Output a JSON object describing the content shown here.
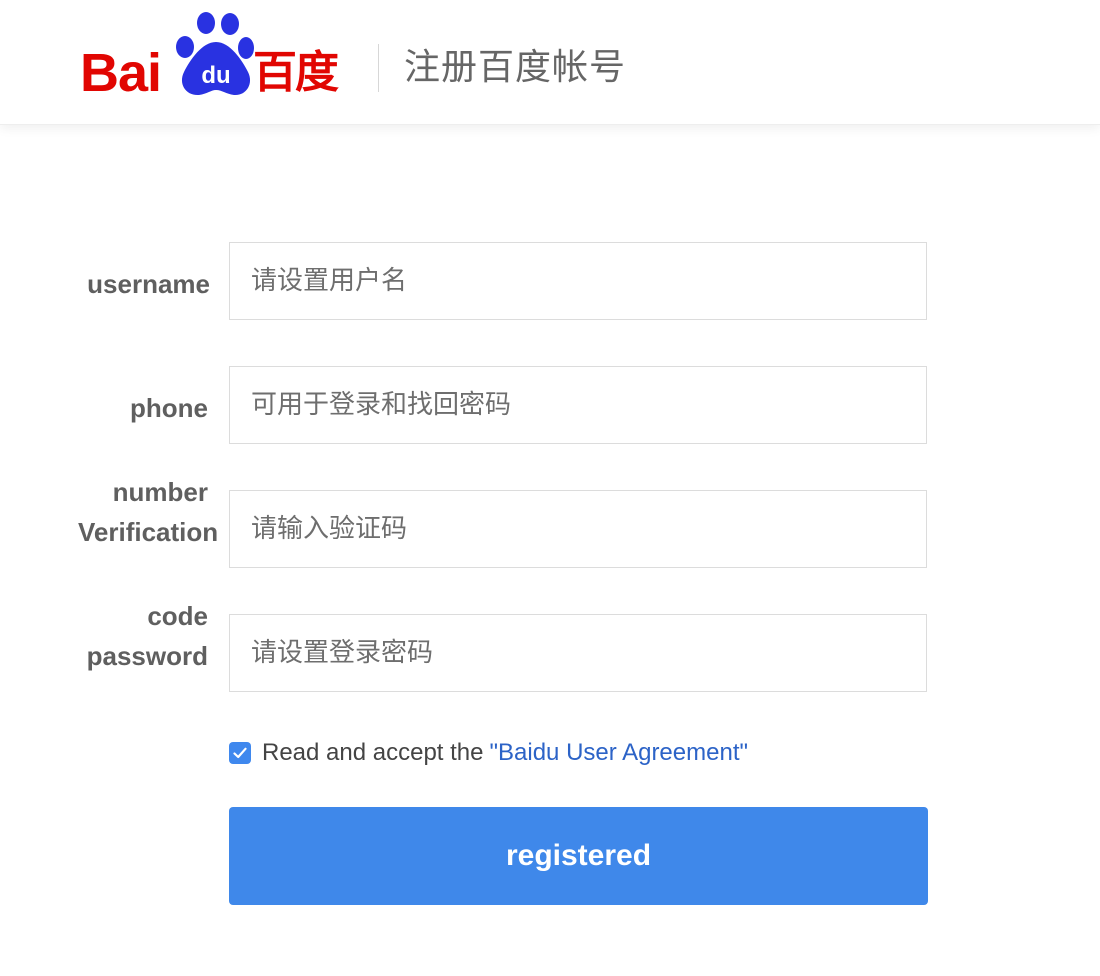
{
  "header": {
    "logo_text_latin": "Bai",
    "logo_paw_text": "du",
    "logo_text_cn": "百度",
    "page_title": "注册百度帐号",
    "brand_red": "#e10602",
    "brand_blue": "#2932e1"
  },
  "form": {
    "username": {
      "label": "username",
      "placeholder": "请设置用户名",
      "value": ""
    },
    "phone": {
      "label": "phone",
      "placeholder": "可用于登录和找回密码",
      "value": ""
    },
    "verification": {
      "label_line1": "number",
      "label_line2": "Verification",
      "placeholder": "请输入验证码",
      "value": ""
    },
    "password": {
      "label_line1": "code",
      "label_line2": "password",
      "placeholder": "请设置登录密码",
      "value": ""
    }
  },
  "agreement": {
    "checked": true,
    "text": "Read and accept the",
    "link_text": "\"Baidu User Agreement\"",
    "checkbox_icon": "checkmark-icon"
  },
  "submit": {
    "label": "registered",
    "color": "#3f88ea"
  }
}
